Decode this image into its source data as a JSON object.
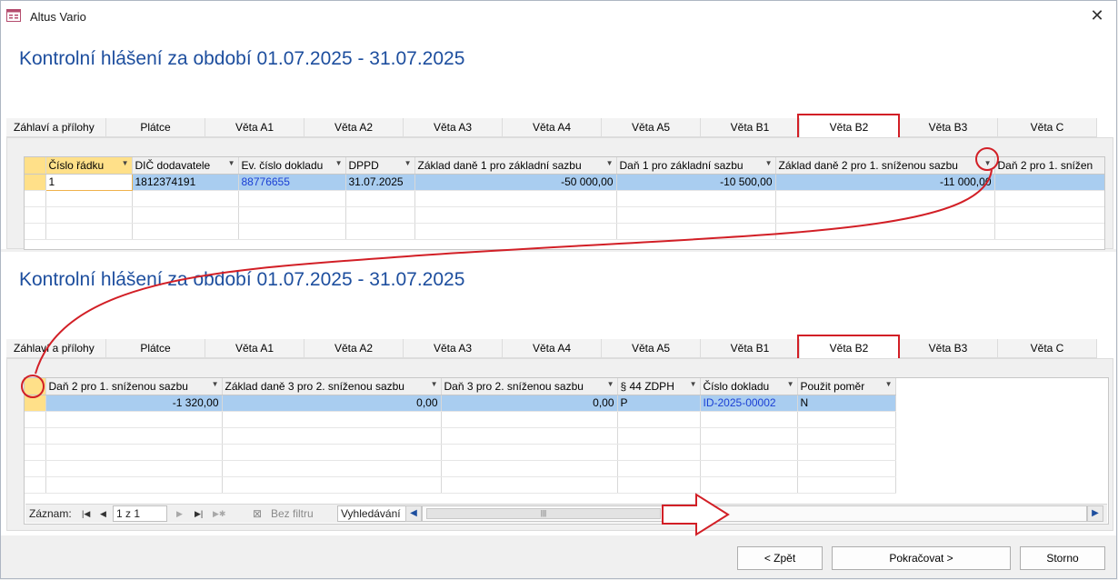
{
  "window": {
    "title": "Altus Vario"
  },
  "heading": "Kontrolní hlášení za období 01.07.2025 - 31.07.2025",
  "tabs": [
    "Záhlaví a přílohy",
    "Plátce",
    "Věta A1",
    "Věta A2",
    "Věta A3",
    "Věta A4",
    "Věta A5",
    "Věta B1",
    "Věta B2",
    "Věta B3",
    "Věta C"
  ],
  "active_tab": "Věta B2",
  "grid_top": {
    "columns": [
      "Číslo řádku",
      "DIČ dodavatele",
      "Ev. číslo dokladu",
      "DPPD",
      "Základ daně 1 pro základní sazbu",
      "Daň 1 pro základní sazbu",
      "Základ daně 2 pro 1. sníženou sazbu",
      "Daň 2 pro 1. snížen"
    ],
    "row": [
      "1",
      "1812374191",
      "88776655",
      "31.07.2025",
      "-50 000,00",
      "-10 500,00",
      "-11 000,00",
      ""
    ]
  },
  "grid_bottom": {
    "columns": [
      "Daň 2 pro 1. sníženou sazbu",
      "Základ daně 3 pro 2. sníženou sazbu",
      "Daň 3 pro 2. sníženou sazbu",
      "§ 44 ZDPH",
      "Číslo dokladu",
      "Použit poměr"
    ],
    "row": [
      "-1 320,00",
      "0,00",
      "0,00",
      "P",
      "ID-2025-00002",
      "N"
    ]
  },
  "navigator": {
    "label": "Záznam:",
    "position": "1 z 1",
    "filter": "Bez filtru",
    "search": "Vyhledávání"
  },
  "buttons": {
    "back": "< Zpět",
    "next": "Pokračovat >",
    "cancel": "Storno"
  },
  "colors": {
    "heading": "#1d4e9e",
    "annotation": "#d21f26",
    "selected_row": "#a9cdf0",
    "selected_cell": "#ffe089"
  }
}
